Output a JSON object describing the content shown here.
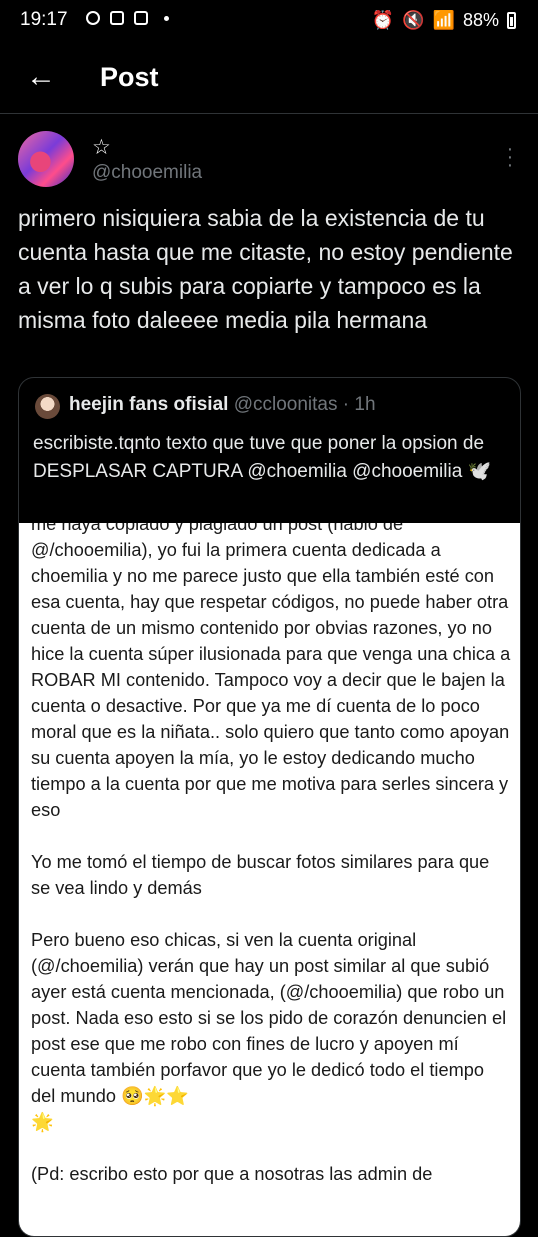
{
  "status_bar": {
    "time": "19:17",
    "battery": "88%"
  },
  "header": {
    "back_icon": "arrow-left-icon",
    "title": "Post"
  },
  "post": {
    "author_display_name": "☆",
    "author_handle": "@chooemilia",
    "text": "primero nisiquiera sabia de la existencia de tu cuenta hasta que me citaste, no estoy pendiente a ver lo q subis para copiarte y tampoco es la misma foto daleeee media pila hermana",
    "more_icon": "more-vertical-icon"
  },
  "quoted_post": {
    "display_name": "heejin fans ofisial",
    "handle": "@ccloonitas",
    "separator": "·",
    "time_ago": "1h",
    "text": "escribiste.tqnto texto que tuve que poner la opsion de DESPLASAR CAPTURA @choemilia @chooemilia 🕊️",
    "screenshot_paragraphs": [
      "me haya copiado y plagiado un post (hablo de @/chooemilia), yo fui la primera cuenta dedicada a choemilia y no me parece justo que ella también esté con esa cuenta, hay que respetar códigos, no puede haber otra cuenta de un mismo contenido por obvias razones, yo no hice la cuenta súper ilusionada para que venga una chica a ROBAR MI contenido. Tampoco voy a decir que le bajen la cuenta o desactive. Por que ya me dí cuenta de lo poco moral que es la niñata.. solo quiero que tanto como apoyan su cuenta apoyen la mía, yo le estoy dedicando mucho tiempo a la cuenta por que me motiva para serles sincera y eso",
      "Yo me tomó el tiempo de buscar fotos similares para que se vea lindo y demás",
      "Pero bueno eso chicas, si ven la cuenta original (@/choemilia) verán que hay un post similar al que subió ayer está cuenta mencionada, (@/chooemilia) que robo un post. Nada eso esto si se los pido de corazón denuncien el post ese que me robo con fines de lucro y apoyen mí cuenta también porfavor que yo le dedicó todo el tiempo del mundo 🥺🌟⭐\n🌟",
      "(Pd: escribo esto por que a nosotras las admin de"
    ]
  }
}
